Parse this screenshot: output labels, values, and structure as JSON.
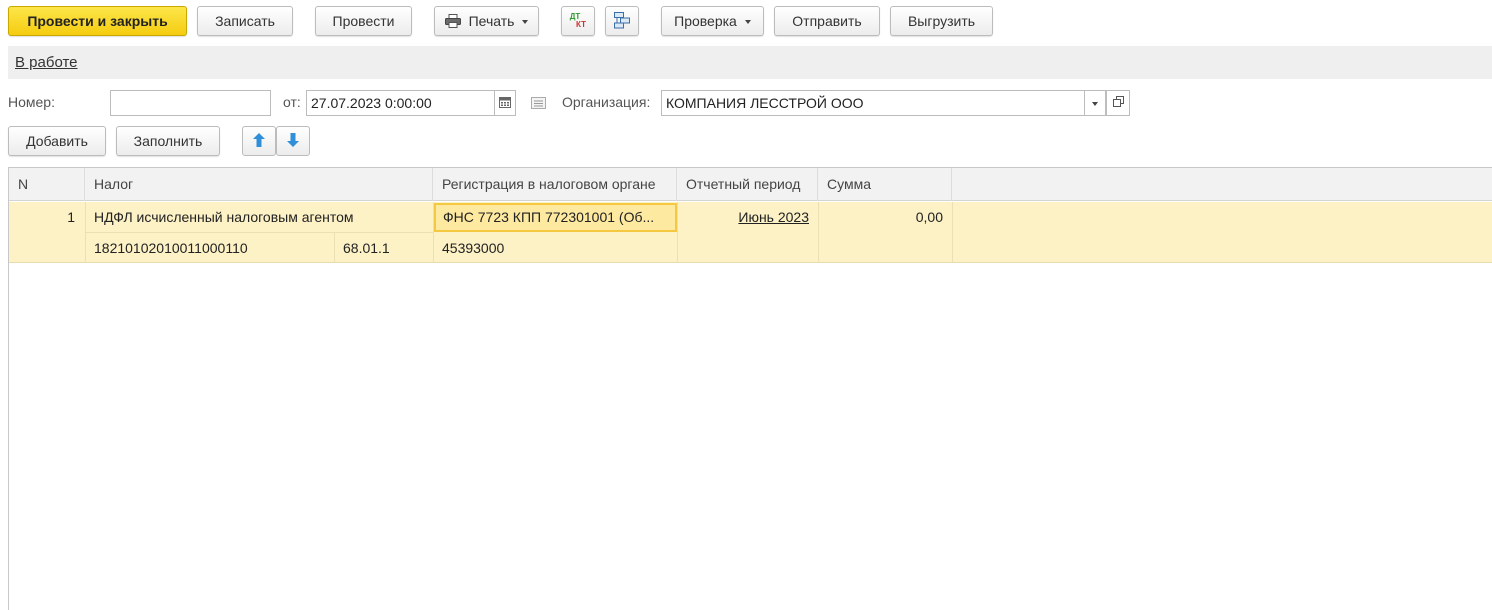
{
  "toolbar": {
    "post_and_close": "Провести и закрыть",
    "save": "Записать",
    "post": "Провести",
    "print": "Печать",
    "dt_kt_top": "ДТ",
    "dt_kt_bottom": "КТ",
    "check": "Проверка",
    "send": "Отправить",
    "export": "Выгрузить"
  },
  "status": {
    "link": "В работе"
  },
  "header": {
    "number_label": "Номер:",
    "number_value": "",
    "date_label": "от:",
    "date_value": "27.07.2023  0:00:00",
    "org_label": "Организация:",
    "org_value": "КОМПАНИЯ ЛЕССТРОЙ ООО"
  },
  "table_toolbar": {
    "add": "Добавить",
    "fill": "Заполнить"
  },
  "table": {
    "columns": [
      "N",
      "Налог",
      "Регистрация в налоговом органе",
      "Отчетный период",
      "Сумма"
    ],
    "rows": [
      {
        "n": "1",
        "tax": "НДФЛ исчисленный налоговым агентом",
        "kbk": "18210102010011000110",
        "account": "68.01.1",
        "registration": "ФНС 7723 КПП 772301001 (Об...",
        "oktmo": "45393000",
        "period": "Июнь 2023",
        "sum": "0,00"
      }
    ]
  },
  "colors": {
    "primary": "#f5d21c",
    "selected_row": "#fdf2c6",
    "selected_cell_border": "#f5c842",
    "arrow_blue": "#2f8fd8"
  }
}
